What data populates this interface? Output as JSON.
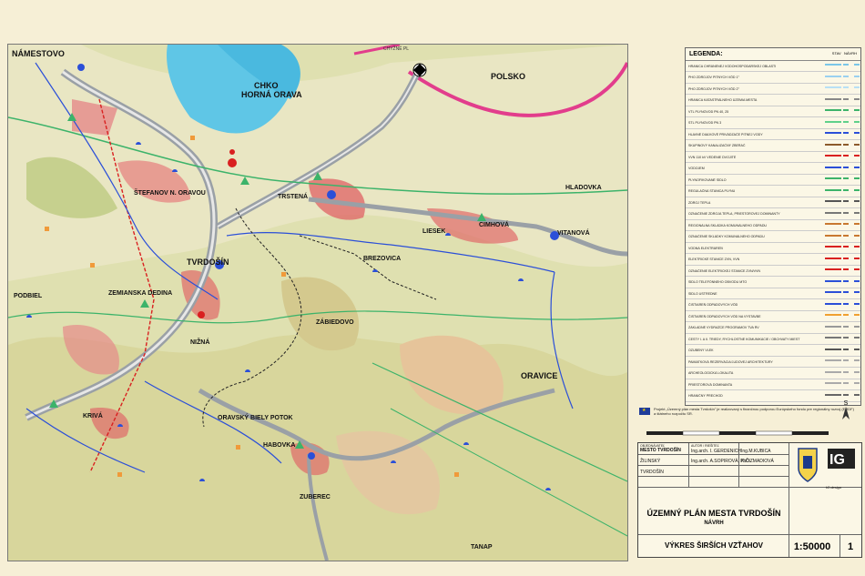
{
  "map": {
    "places": [
      {
        "id": "namestovo",
        "text": "NÁMESTOVO"
      },
      {
        "id": "chko1",
        "text": "CHKO"
      },
      {
        "id": "chko2",
        "text": "HORNÁ ORAVA"
      },
      {
        "id": "polsko",
        "text": "POLSKO"
      },
      {
        "id": "chyzne",
        "text": "CHYŽNÉ PL"
      },
      {
        "id": "stefanov",
        "text": "ŠTEFANOV N. ORAVOU"
      },
      {
        "id": "trstena",
        "text": "TRSTENÁ"
      },
      {
        "id": "hladovka",
        "text": "HLADOVKA"
      },
      {
        "id": "liesek",
        "text": "LIESEK"
      },
      {
        "id": "cimhova",
        "text": "CIMHOVÁ"
      },
      {
        "id": "vitanova",
        "text": "VITANOVÁ"
      },
      {
        "id": "tvrdosin",
        "text": "TVRDOŠÍN"
      },
      {
        "id": "brezovica",
        "text": "BREZOVICA"
      },
      {
        "id": "zemianska",
        "text": "ZEMIANSKA DEDINA"
      },
      {
        "id": "podbiel",
        "text": "PODBIEL"
      },
      {
        "id": "nizna",
        "text": "NIŽNÁ"
      },
      {
        "id": "zabiedovo",
        "text": "ZÁBIEDOVO"
      },
      {
        "id": "oravice",
        "text": "ORAVICE"
      },
      {
        "id": "krva",
        "text": "KRIVÁ"
      },
      {
        "id": "biely",
        "text": "ORAVSKÝ BIELY POTOK"
      },
      {
        "id": "habovka",
        "text": "HABOVKA"
      },
      {
        "id": "zuberec",
        "text": "ZUBEREC"
      },
      {
        "id": "tatry",
        "text": "TANAP"
      }
    ]
  },
  "legend": {
    "title": "LEGENDA:",
    "col_stav": "STAV",
    "col_navrh": "NÁVRH",
    "items": [
      {
        "label": "HRANICA CHRÁNENEJ VODOHOSPODÁRSKEJ OBLASTI",
        "color": "#7bc6e8"
      },
      {
        "label": "PHO ZDROJOV PITNÝCH VÔD 1°",
        "color": "#9ad0f0"
      },
      {
        "label": "PHO ZDROJOV PITNÝCH VÔD 2°",
        "color": "#b8e0f5"
      },
      {
        "label": "HRANICA KATASTRÁLNEHO ÚZEMIA MESTA",
        "color": "#888888"
      },
      {
        "label": "VTL PLYNOVOD PN 40, 25",
        "color": "#3cb36a"
      },
      {
        "label": "STL PLYNOVOD PN 3",
        "color": "#5fd08a"
      },
      {
        "label": "HLAVNÉ DIAĽKOVÉ PRIVÁDZAČE PITNEJ VODY",
        "color": "#2b4fd8"
      },
      {
        "label": "SKUPINOVÝ KANALIZAČNÝ ZBERAČ",
        "color": "#8c5a2b"
      },
      {
        "label": "VVN 110 kV VEDENIE DVOJITÉ",
        "color": "#d92020"
      },
      {
        "label": "VODOJEM",
        "color": "#2b4fd8"
      },
      {
        "label": "PLYNOFIKOVANÉ SÍDLO",
        "color": "#3cb36a"
      },
      {
        "label": "REGULAČNÁ STANICA PLYNU",
        "color": "#3cb36a"
      },
      {
        "label": "ZDROJ TEPLA",
        "color": "#555555"
      },
      {
        "label": "OZNAČENIE ZDROJA TEPLA, PRIESTOROVEJ DOMINANTY",
        "color": "#777777"
      },
      {
        "label": "REGIONÁLNA SKLÁDKA KOMUNÁLNEHO ODPADU",
        "color": "#c87830"
      },
      {
        "label": "OZNAČENIE SKLÁDKY KOMUNÁLNEHO ODPADU",
        "color": "#c87830"
      },
      {
        "label": "VODNÁ ELEKTRÁREŇ",
        "color": "#d92020"
      },
      {
        "label": "ELEKTRICKÉ STANICE ZVN, VVN",
        "color": "#d92020"
      },
      {
        "label": "OZNAČENIE ELEKTRICKEJ STANICE ZVN/VVN",
        "color": "#d92020"
      },
      {
        "label": "SÍDLO TELEFÓNNEHO OBVODU MTO",
        "color": "#2b4fd8"
      },
      {
        "label": "SÍDLO USTREDNE",
        "color": "#2b4fd8"
      },
      {
        "label": "ČISTIAREŇ ODPADOVÝCH VÔD",
        "color": "#2b4fd8"
      },
      {
        "label": "ČISTIAREŇ ODPADOVÝCH VÔD NA VÝSTAVBE",
        "color": "#f0a030"
      },
      {
        "label": "ZÁKLADNÉ VYDRAŽCE PROGRAMOV TVA RV",
        "color": "#999999"
      },
      {
        "label": "CESTY I. A II. TRIEDY, RÝCHLOSTNÉ KOMUNIKÁCIE / OBCHVATY MIEST",
        "color": "#777777"
      },
      {
        "label": "OZUBENÝ VLEK",
        "color": "#555555"
      },
      {
        "label": "PAMIATKOVÁ REZERVÁCIA ĽUDOVEJ ARCHITEKTÚRY",
        "color": "#aaaaaa"
      },
      {
        "label": "ARCHEOLOGICKÁ LOKALITA",
        "color": "#aaaaaa"
      },
      {
        "label": "PRIESTOROVÁ DOMINANTA",
        "color": "#aaaaaa"
      },
      {
        "label": "HRANIČNÝ PRECHOD",
        "color": "#666666"
      }
    ]
  },
  "eu_note": "Projekt „Územný plán mesta Tvrdošín\" je realizovaný s finančnou podporou Európskeho fondu pre regionálny rozvoj (ERDF) a štátneho rozpočtu SR.",
  "north_label": "S",
  "title_block": {
    "client_label": "OBJEDNÁVATEĽ",
    "author_label": "AUTOR / RIEŠITEĽ",
    "client": "MESTO TVRDOŠÍN",
    "author1": "Ing.arch. I. GERDENICH",
    "author2": "Ing.M.KUBICA",
    "region": "ŽILINSKÝ",
    "author3": "Ing.arch. A.SOPIROVÁ, PhD.",
    "author4": "K.ČIZMADIOVÁ",
    "district": "TVRDOŠÍN",
    "company": "IG design",
    "project_title": "ÚZEMNÝ PLÁN MESTA TVRDOŠÍN",
    "project_sub": "NÁVRH",
    "drawing_title": "VÝKRES ŠIRŠÍCH VZŤAHOV",
    "scale": "1:50000",
    "sheet_no": "1"
  }
}
